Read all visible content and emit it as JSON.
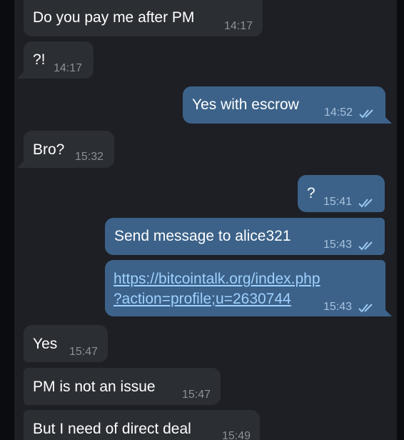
{
  "messages": [
    {
      "direction": "incoming",
      "text": "Do you pay me after PM",
      "time": "14:17"
    },
    {
      "direction": "incoming",
      "text": "?!",
      "time": "14:17"
    },
    {
      "direction": "outgoing",
      "text": "Yes with escrow",
      "time": "14:52",
      "status": "read",
      "status_icon": "double-check-icon"
    },
    {
      "direction": "incoming",
      "text": "Bro?",
      "time": "15:32"
    },
    {
      "direction": "outgoing",
      "text": "?",
      "time": "15:41",
      "status": "read",
      "status_icon": "double-check-icon"
    },
    {
      "direction": "outgoing",
      "text": "Send message to alice321",
      "time": "15:43",
      "status": "read",
      "status_icon": "double-check-icon"
    },
    {
      "direction": "outgoing",
      "link_line1": "https://bitcointalk.org/index.php",
      "link_line2": "?action=profile;u=2630744",
      "time": "15:43",
      "status": "read",
      "status_icon": "double-check-icon"
    },
    {
      "direction": "incoming",
      "text": "Yes",
      "time": "15:47"
    },
    {
      "direction": "incoming",
      "text": "PM is not an issue",
      "time": "15:47"
    },
    {
      "direction": "incoming",
      "text": "But I need of direct deal",
      "time": "15:49"
    }
  ],
  "colors": {
    "background": "#1d1f24",
    "incoming_bubble": "#2b2e33",
    "outgoing_bubble": "#3c6289",
    "link": "#9fd1ff",
    "check_icon": "#9cc8f2"
  }
}
